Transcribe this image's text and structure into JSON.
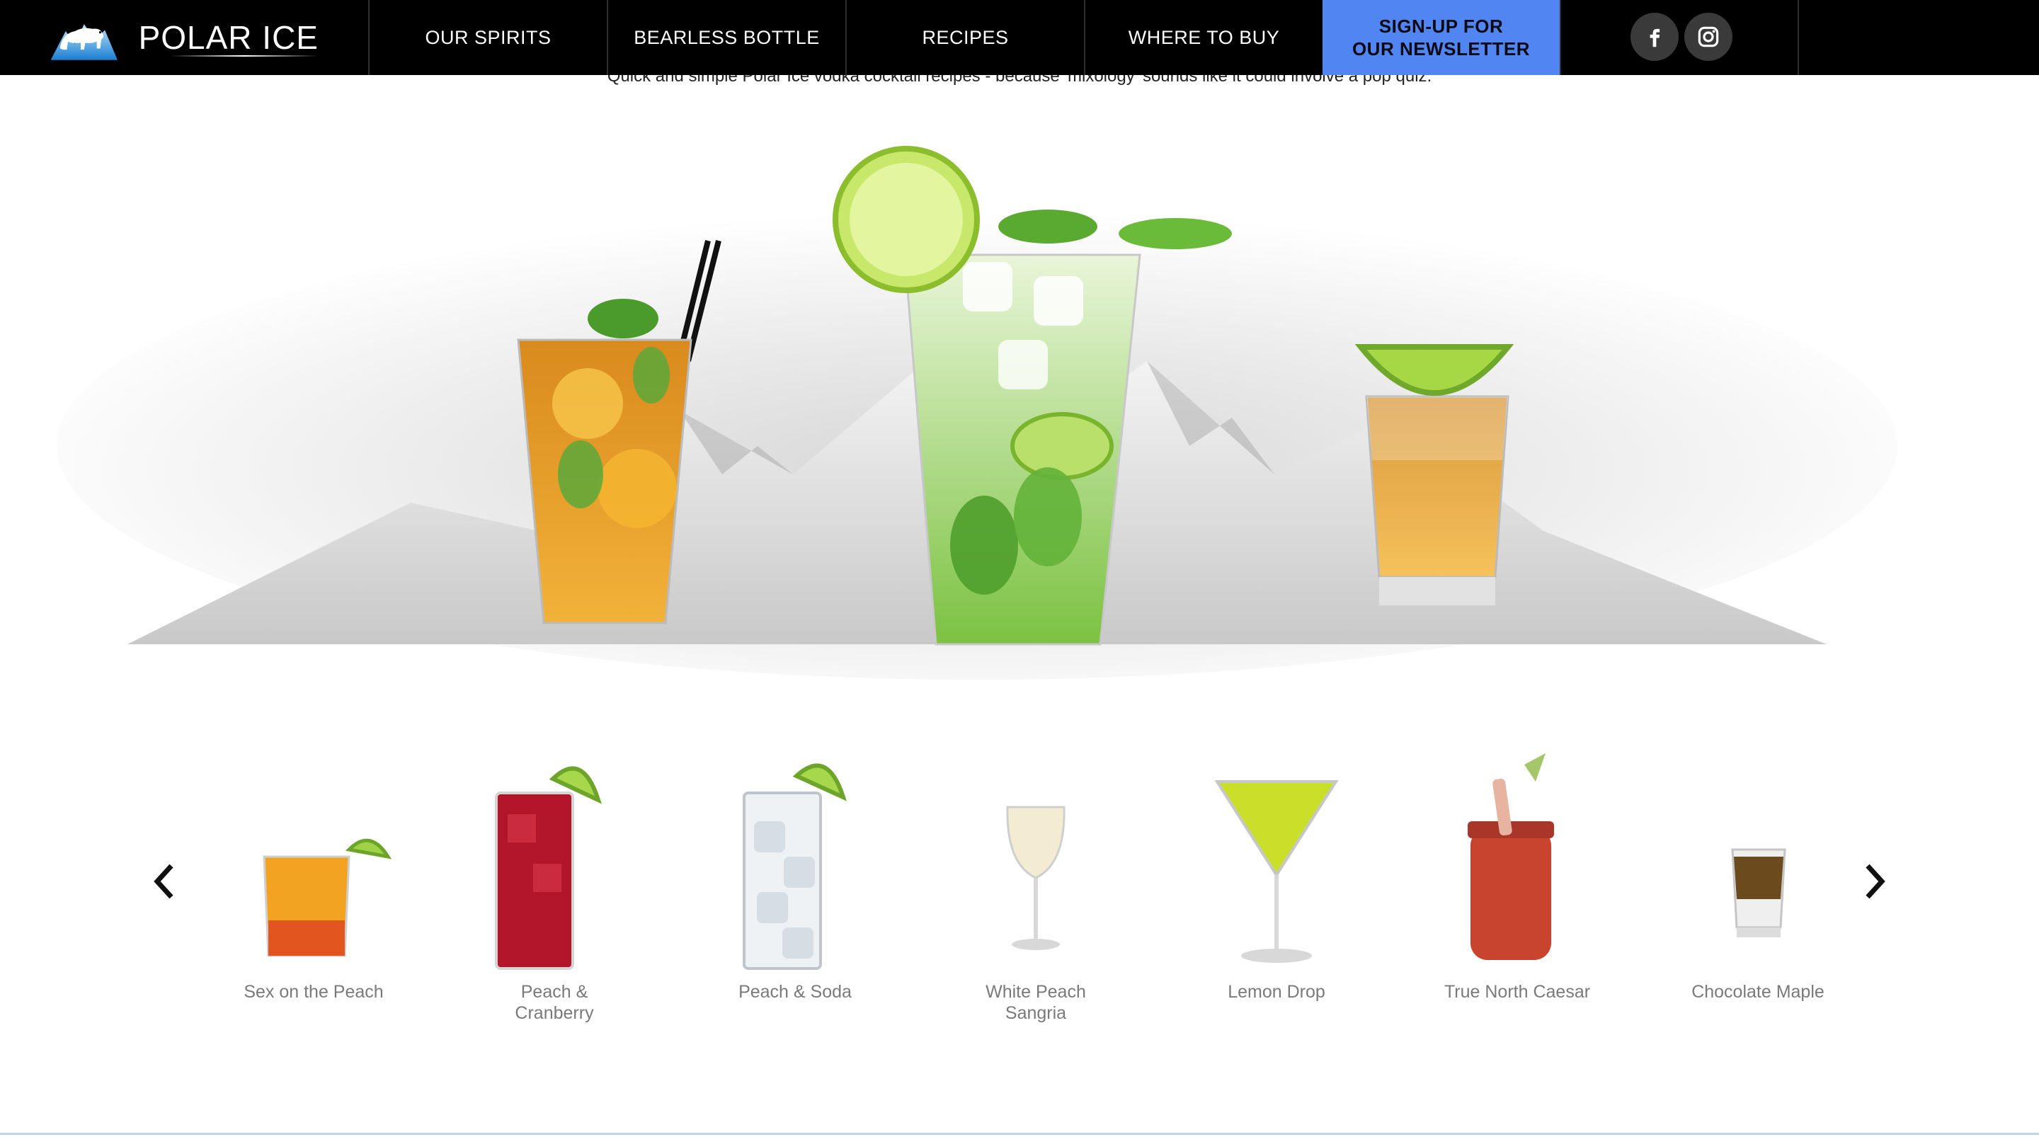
{
  "brand": {
    "name": "POLAR ICE"
  },
  "nav": {
    "items": [
      {
        "label": "OUR SPIRITS"
      },
      {
        "label": "BEARLESS BOTTLE"
      },
      {
        "label": "RECIPES"
      },
      {
        "label": "WHERE TO BUY"
      }
    ],
    "signup_line1": "SIGN-UP FOR",
    "signup_line2": "OUR NEWSLETTER"
  },
  "social": [
    {
      "icon": "facebook-icon"
    },
    {
      "icon": "instagram-icon"
    }
  ],
  "intro": "Quick and simple Polar Ice vodka cocktail recipes - because 'mixology' sounds like it could involve a pop quiz.",
  "recipes": [
    {
      "name": "Sex on the Peach",
      "icon": "rocks-glass-orange-icon"
    },
    {
      "name": "Peach &\nCranberry",
      "icon": "highball-cranberry-icon"
    },
    {
      "name": "Peach & Soda",
      "icon": "highball-soda-icon"
    },
    {
      "name": "White Peach\nSangria",
      "icon": "wine-glass-sangria-icon"
    },
    {
      "name": "Lemon Drop",
      "icon": "martini-glass-icon"
    },
    {
      "name": "True North Caesar",
      "icon": "mason-jar-caesar-icon"
    },
    {
      "name": "Chocolate Maple",
      "icon": "shot-glass-icon"
    }
  ],
  "colors": {
    "header_bg": "#000000",
    "signup_bg": "#5186f2",
    "label_text": "#7a7a7a"
  }
}
